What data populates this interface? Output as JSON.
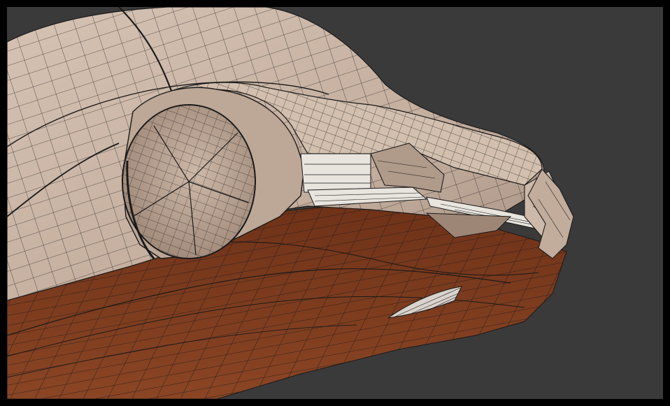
{
  "viewport": {
    "label": "",
    "background_color": "#3a3a3a",
    "frame_color": "#000000"
  },
  "model": {
    "subject": "car-front-wireframe",
    "shell_color": "#c8b4a4",
    "shell_shade_color": "#a8907f",
    "floor_color": "#7a3a1f",
    "floor_shade_color": "#5e2a14",
    "wire_color": "#1a1a1a",
    "trim_color": "#e6e2dc"
  }
}
